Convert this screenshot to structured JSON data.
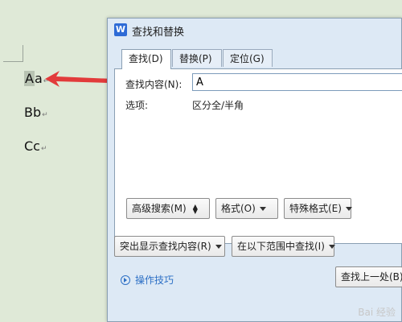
{
  "document": {
    "lines": [
      "Aa",
      "Bb",
      "Cc"
    ],
    "paragraph_mark": "↵"
  },
  "dialog": {
    "icon_letter": "W",
    "title": "查找和替换",
    "tabs": [
      "查找(D)",
      "替换(P)",
      "定位(G)"
    ],
    "find_label": "查找内容(N):",
    "find_value": "A",
    "options_label": "选项:",
    "options_value": "区分全/半角",
    "buttons": {
      "advanced": "高级搜索(M)",
      "format": "格式(O)",
      "special": "特殊格式(E)",
      "highlight": "突出显示查找内容(R)",
      "scope": "在以下范围中查找(I)",
      "find_prev": "查找上一处(B)"
    },
    "tips": "操作技巧"
  },
  "watermark": "Bai 经验",
  "colors": {
    "background": "#dfe9d7",
    "arrow": "#e23b3b",
    "link": "#2c6fc5"
  }
}
